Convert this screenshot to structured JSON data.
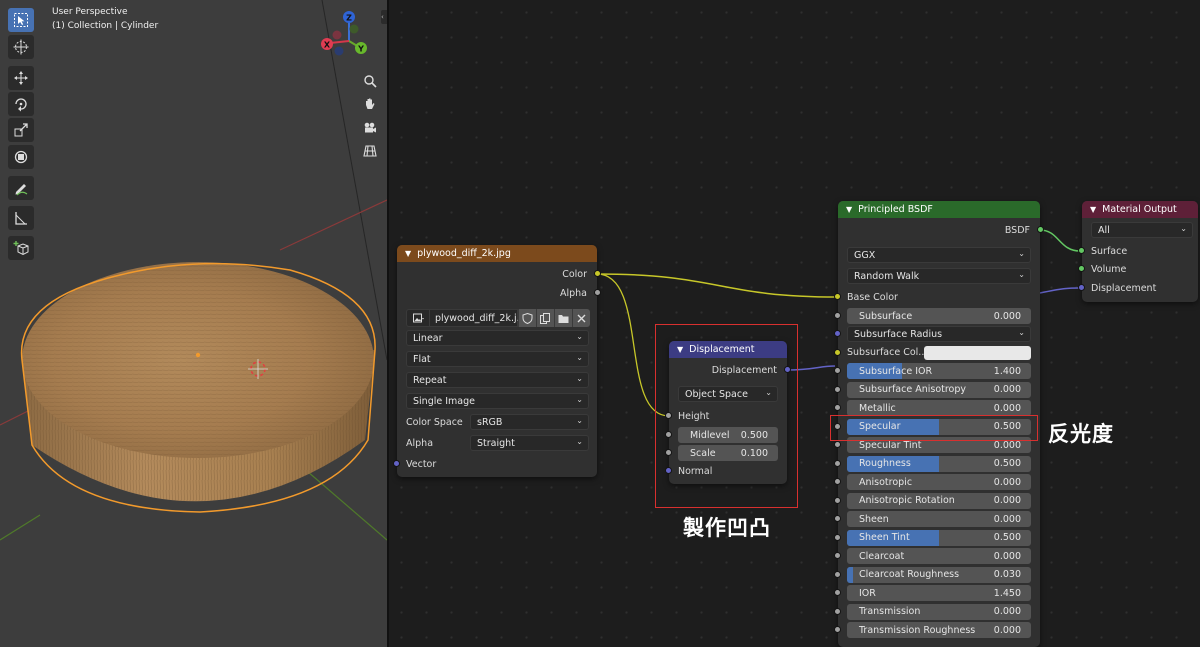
{
  "viewport": {
    "title": "User Perspective",
    "subtitle": "(1) Collection | Cylinder",
    "tools": [
      "select-box-icon",
      "cursor-icon",
      "move-icon",
      "rotate-icon",
      "scale-icon",
      "transform-icon",
      "annotate-icon",
      "measure-icon",
      "add-cube-icon"
    ],
    "gizmo": {
      "z": "Z",
      "y": "Y",
      "x": "X"
    },
    "nav_buttons": [
      "zoom-icon",
      "hand-icon",
      "camera-icon",
      "grid-icon"
    ]
  },
  "image_node": {
    "title": "plywood_diff_2k.jpg",
    "outputs": [
      "Color",
      "Alpha"
    ],
    "image_name": "plywood_diff_2k.j...",
    "interpolation": "Linear",
    "projection": "Flat",
    "extension": "Repeat",
    "source": "Single Image",
    "color_space_label": "Color Space",
    "color_space": "sRGB",
    "alpha_label": "Alpha",
    "alpha": "Straight",
    "vector_label": "Vector"
  },
  "displacement_node": {
    "title": "Displacement",
    "output": "Displacement",
    "space": "Object Space",
    "height_label": "Height",
    "midlevel_label": "Midlevel",
    "midlevel": "0.500",
    "scale_label": "Scale",
    "scale": "0.100",
    "normal_label": "Normal"
  },
  "bsdf_node": {
    "title": "Principled BSDF",
    "output": "BSDF",
    "distribution": "GGX",
    "subsurface_method": "Random Walk",
    "base_color_label": "Base Color",
    "subsurface_label": "Subsurface",
    "subsurface": "0.000",
    "subsurface_radius": "Subsurface Radius",
    "subsurface_color_label": "Subsurface Col...",
    "fields": [
      {
        "label": "Subsurface IOR",
        "value": "1.400",
        "fill": 0.3
      },
      {
        "label": "Subsurface Anisotropy",
        "value": "0.000",
        "fill": 0
      },
      {
        "label": "Metallic",
        "value": "0.000",
        "fill": 0
      },
      {
        "label": "Specular",
        "value": "0.500",
        "fill": 0.5
      },
      {
        "label": "Specular Tint",
        "value": "0.000",
        "fill": 0
      },
      {
        "label": "Roughness",
        "value": "0.500",
        "fill": 0.5
      },
      {
        "label": "Anisotropic",
        "value": "0.000",
        "fill": 0
      },
      {
        "label": "Anisotropic Rotation",
        "value": "0.000",
        "fill": 0
      },
      {
        "label": "Sheen",
        "value": "0.000",
        "fill": 0
      },
      {
        "label": "Sheen Tint",
        "value": "0.500",
        "fill": 0.5
      },
      {
        "label": "Clearcoat",
        "value": "0.000",
        "fill": 0
      },
      {
        "label": "Clearcoat Roughness",
        "value": "0.030",
        "fill": 0.03
      },
      {
        "label": "IOR",
        "value": "1.450",
        "fill": 0
      },
      {
        "label": "Transmission",
        "value": "0.000",
        "fill": 0
      },
      {
        "label": "Transmission Roughness",
        "value": "0.000",
        "fill": 0
      }
    ]
  },
  "output_node": {
    "title": "Material Output",
    "target": "All",
    "inputs": [
      "Surface",
      "Volume",
      "Displacement"
    ]
  },
  "annotations": {
    "bump": "製作凹凸",
    "specular": "反光度"
  },
  "colors": {
    "accent": "#4772b3",
    "annotation": "#d8302f",
    "socket_color": "#c7c729",
    "socket_float": "#a1a1a1",
    "socket_vector": "#6363c7",
    "socket_shader": "#63c763"
  }
}
